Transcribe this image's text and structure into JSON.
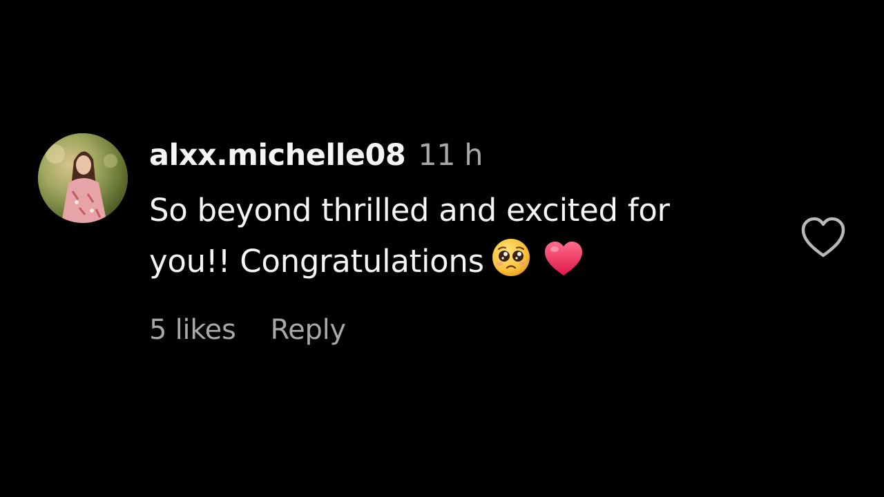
{
  "comment": {
    "username": "alxx.michelle08",
    "timestamp": "11 h",
    "text_lines": [
      "So beyond thrilled and excited for",
      "you!! Congratulations"
    ],
    "emojis": [
      "pleading-face-emoji",
      "red-heart-emoji"
    ],
    "likes": "5 likes",
    "reply_label": "Reply",
    "like_icon": "heart-outline-icon"
  },
  "colors": {
    "background": "#000000",
    "primary_text": "#f5f5f5",
    "secondary_text": "#a8a8a8"
  }
}
